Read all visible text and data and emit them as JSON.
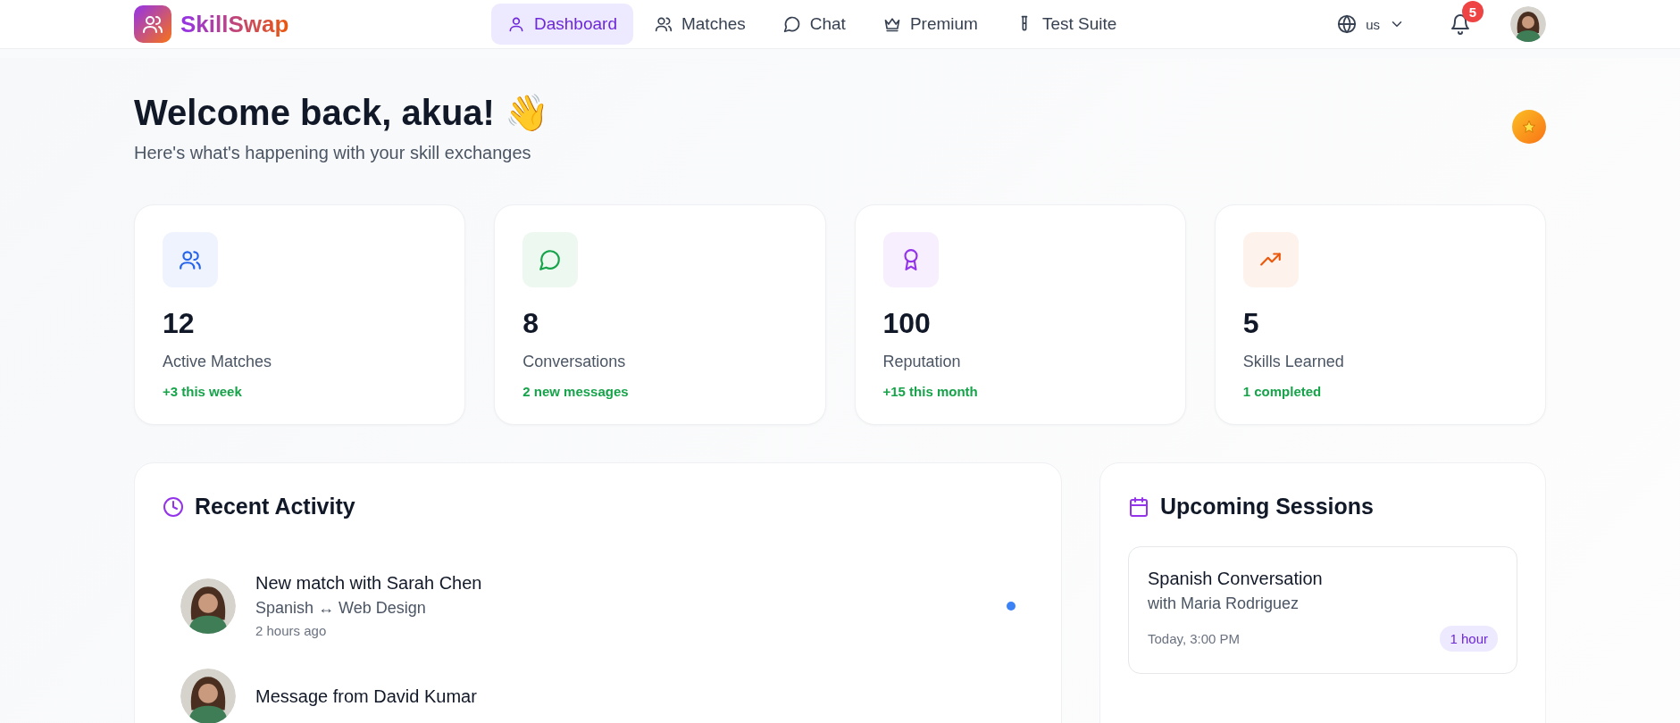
{
  "brand": {
    "name": "SkillSwap"
  },
  "nav": [
    {
      "label": "Dashboard",
      "selected": true
    },
    {
      "label": "Matches",
      "selected": false
    },
    {
      "label": "Chat",
      "selected": false
    },
    {
      "label": "Premium",
      "selected": false
    },
    {
      "label": "Test Suite",
      "selected": false
    }
  ],
  "language": "us",
  "notifications": "5",
  "welcome": {
    "title": "Welcome back, akua! 👋",
    "subtitle": "Here's what's happening with your skill exchanges"
  },
  "stats": [
    {
      "color": "#2563eb",
      "value": "12",
      "label": "Active Matches",
      "change": "+3 this week"
    },
    {
      "color": "#16a34a",
      "value": "8",
      "label": "Conversations",
      "change": "2 new messages"
    },
    {
      "color": "#9333ea",
      "value": "100",
      "label": "Reputation",
      "change": "+15 this month"
    },
    {
      "color": "#ea580c",
      "value": "5",
      "label": "Skills Learned",
      "change": "1 completed"
    }
  ],
  "recent_activity": {
    "title": "Recent Activity",
    "items": [
      {
        "title": "New match with Sarah Chen",
        "detail": "Spanish ↔ Web Design",
        "time": "2 hours ago",
        "unread": true
      },
      {
        "title": "Message from David Kumar",
        "unread": false
      }
    ]
  },
  "upcoming_sessions": {
    "title": "Upcoming Sessions",
    "items": [
      {
        "title": "Spanish Conversation",
        "partner": "with Maria Rodriguez",
        "time": "Today, 3:00 PM",
        "duration": "1 hour"
      }
    ]
  }
}
